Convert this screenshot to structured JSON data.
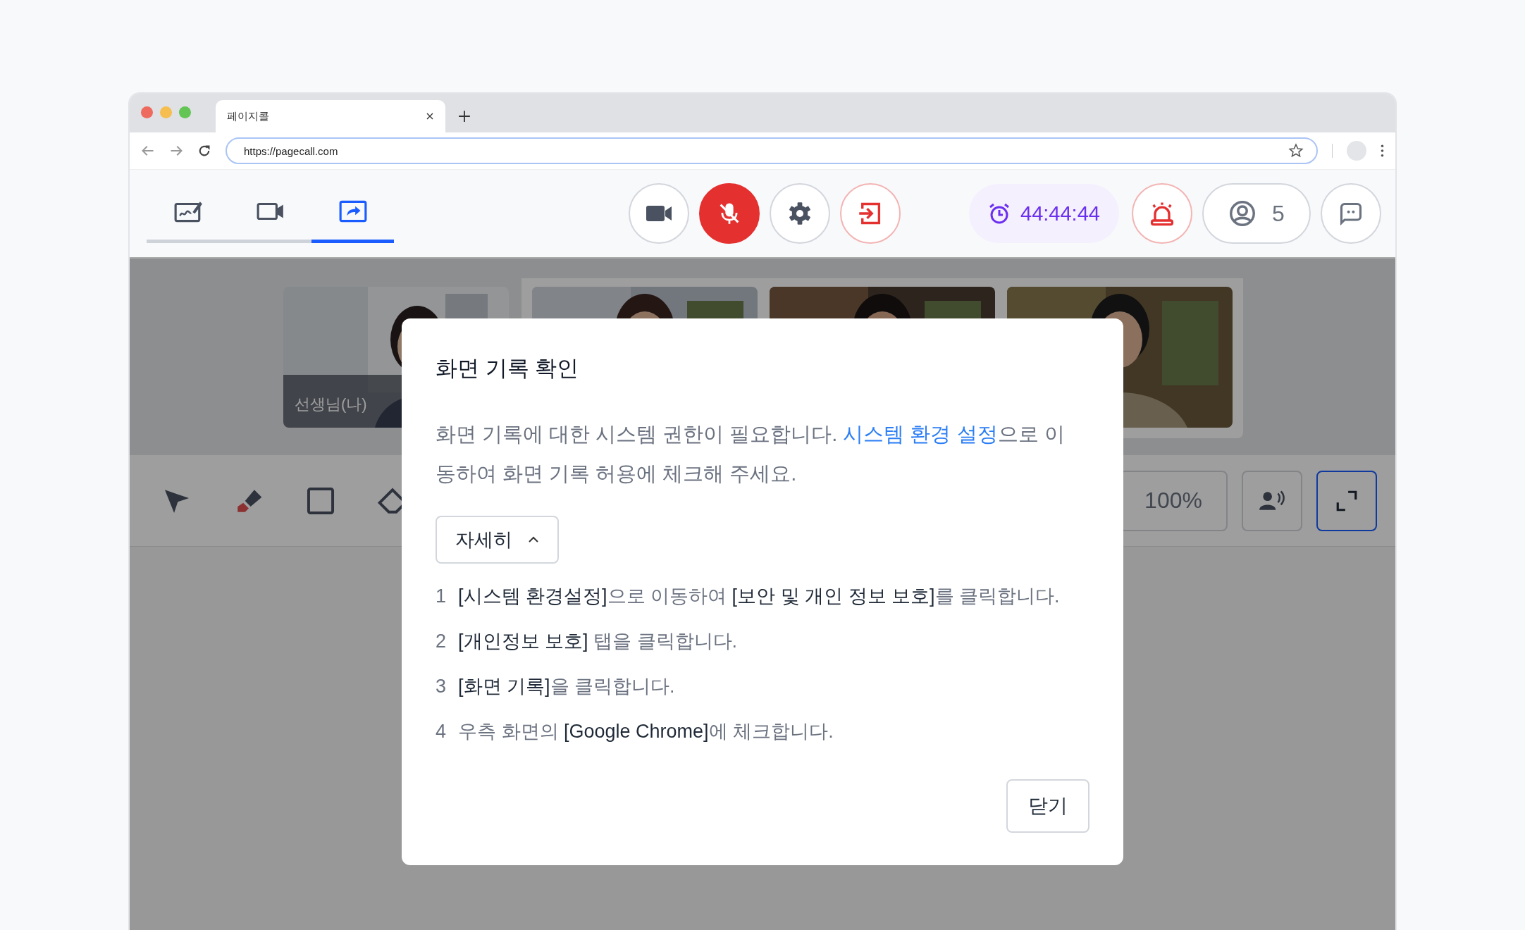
{
  "browser": {
    "tab_title": "페이지콜",
    "url": "https://pagecall.com"
  },
  "app_tabs": [
    {
      "kind": "board",
      "selected": false
    },
    {
      "kind": "video",
      "selected": false
    },
    {
      "kind": "share",
      "selected": true
    }
  ],
  "controls": [
    {
      "kind": "camera",
      "muted": false
    },
    {
      "kind": "mic",
      "muted": true
    },
    {
      "kind": "settings",
      "muted": false
    },
    {
      "kind": "exit",
      "muted": false
    }
  ],
  "timer": "44:44:44",
  "participants": "5",
  "video_tiles": [
    {
      "kind": "picture",
      "label": "선생님(나)"
    },
    {
      "kind": "picture"
    },
    {
      "kind": "picture"
    },
    {
      "kind": "picture"
    }
  ],
  "drawing_tools": [
    {
      "kind": "pointer"
    },
    {
      "kind": "pen"
    },
    {
      "kind": "rectangle"
    },
    {
      "kind": "eraser"
    }
  ],
  "zoom": "100%",
  "dialog": {
    "title": "화면 기록 확인",
    "message_before": "화면 기록에 대한 시스템 권한이 필요합니다. ",
    "link": "시스템 환경 설정",
    "message_after": "으로 이동하여 화면 기록 허용에 체크해 주세요.",
    "details_button": "자세히",
    "expanded": true,
    "steps": [
      {
        "number": "1",
        "text": "**[시스템 환경설정]**으로 이동하여 **[보안 및 개인 정보 보호]**를 클릭합니다."
      },
      {
        "number": "2",
        "text": "**[개인정보 보호]** 탭을 클릭합니다."
      },
      {
        "number": "3",
        "text": "**[화면 기록]**을 클릭합니다."
      },
      {
        "number": "4",
        "text": "우측 화면의 **[Google Chrome]**에 체크합니다."
      }
    ],
    "close_button": "닫기"
  }
}
